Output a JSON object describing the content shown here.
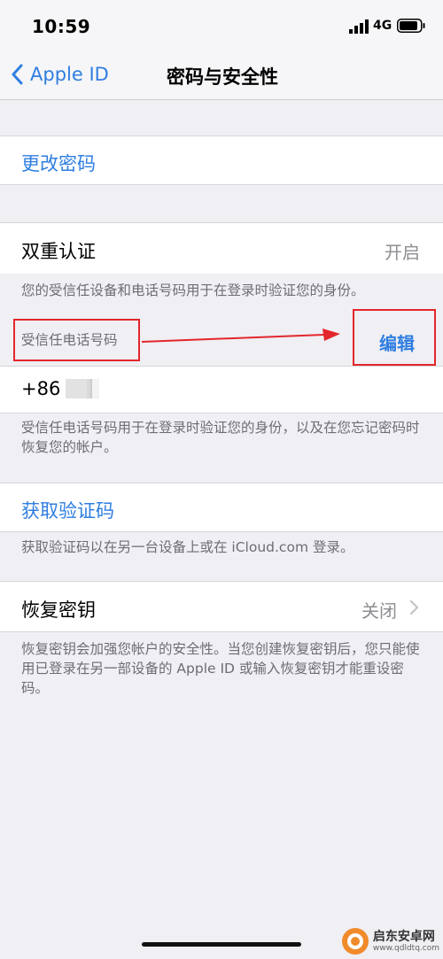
{
  "status_bar": {
    "time": "10:59",
    "network": "4G"
  },
  "nav": {
    "back_label": "Apple ID",
    "title": "密码与安全性"
  },
  "change_password": {
    "label": "更改密码"
  },
  "two_factor": {
    "label": "双重认证",
    "value": "开启",
    "description": "您的受信任设备和电话号码用于在登录时验证您的身份。",
    "trusted_numbers_header": "受信任电话号码",
    "edit_label": "编辑",
    "phone_prefix": "+86",
    "phone_footer": "受信任电话号码用于在登录时验证您的身份，以及在您忘记密码时恢复您的帐户。"
  },
  "get_code": {
    "label": "获取验证码",
    "footer": "获取验证码以在另一台设备上或在 iCloud.com 登录。"
  },
  "recovery_key": {
    "label": "恢复密钥",
    "value": "关闭",
    "footer": "恢复密钥会加强您帐户的安全性。当您创建恢复密钥后，您只能使用已登录在另一部设备的 Apple ID 或输入恢复密钥才能重设密码。"
  },
  "watermark": {
    "name": "启东安卓网",
    "url": "www.qdldtq.com"
  },
  "colors": {
    "accent": "#2f7ee0",
    "annotation": "#e3262b",
    "background": "#efeff4"
  }
}
